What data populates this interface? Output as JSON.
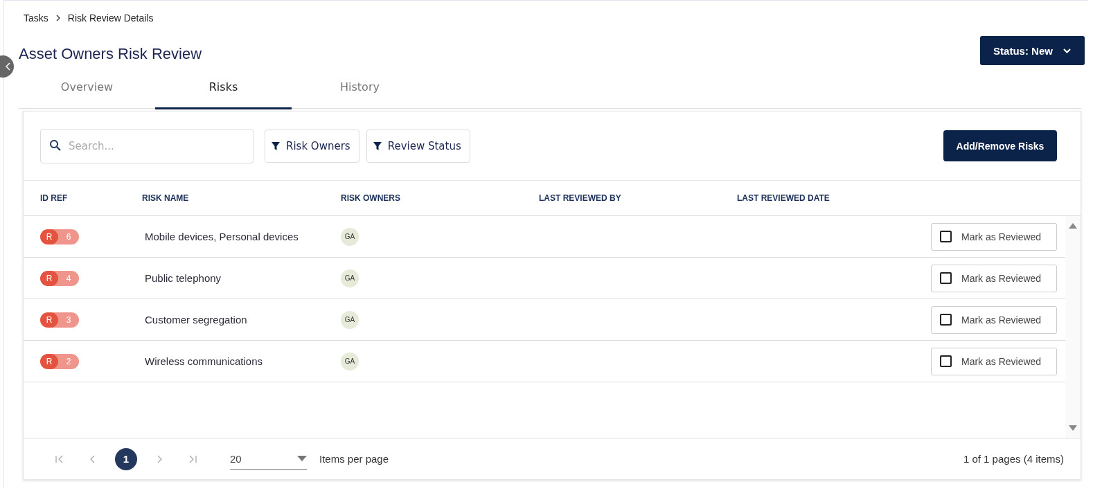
{
  "breadcrumb": [
    "Tasks",
    "Risk Review Details"
  ],
  "title": "Asset Owners Risk Review",
  "status_button": "Status: New",
  "tabs": [
    {
      "label": "Overview",
      "selected": false
    },
    {
      "label": "Risks",
      "selected": true
    },
    {
      "label": "History",
      "selected": false
    }
  ],
  "search": {
    "placeholder": "Search..."
  },
  "filters": [
    "Risk Owners",
    "Review Status"
  ],
  "add_button": "Add/Remove Risks",
  "table": {
    "columns": [
      "ID REF",
      "RISK NAME",
      "RISK OWNERS",
      "LAST REVIEWED BY",
      "LAST REVIEWED DATE"
    ],
    "rows": [
      {
        "id_prefix": "R",
        "id_number": "6",
        "name": "Mobile devices, Personal devices",
        "owner": "GA",
        "checked": false,
        "action": "Mark as Reviewed"
      },
      {
        "id_prefix": "R",
        "id_number": "4",
        "name": "Public telephony",
        "owner": "GA",
        "checked": false,
        "action": "Mark as Reviewed"
      },
      {
        "id_prefix": "R",
        "id_number": "3",
        "name": "Customer segregation",
        "owner": "GA",
        "checked": false,
        "action": "Mark as Reviewed"
      },
      {
        "id_prefix": "R",
        "id_number": "2",
        "name": "Wireless communications",
        "owner": "GA",
        "checked": false,
        "action": "Mark as Reviewed"
      }
    ]
  },
  "pager": {
    "pages": [
      {
        "label": "1",
        "selected": true
      }
    ],
    "page_size": "20",
    "page_size_label": "Items per page",
    "summary": "1 of 1 pages (4 items)"
  }
}
